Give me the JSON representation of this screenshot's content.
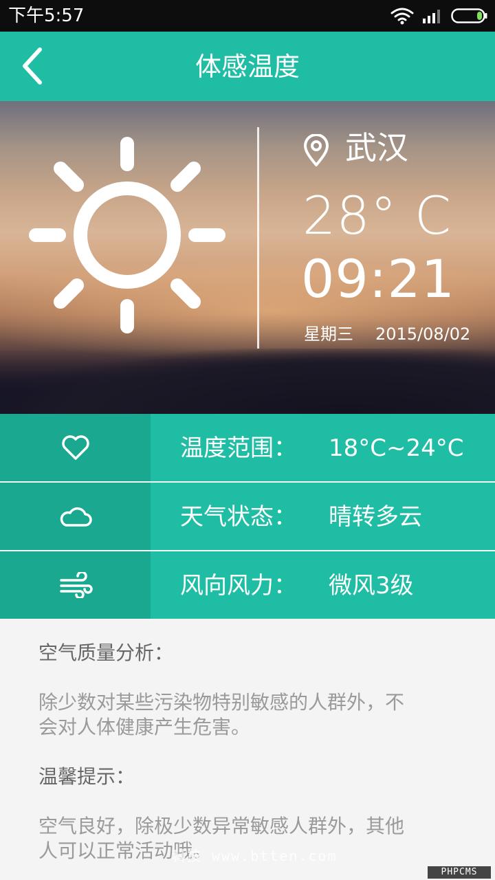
{
  "status_bar": {
    "time": "下午5:57",
    "icons": [
      "wifi-icon",
      "signal-icon",
      "battery-icon"
    ]
  },
  "app_bar": {
    "title": "体感温度",
    "back_icon": "chevron-left-icon"
  },
  "hero": {
    "location_icon": "map-pin-icon",
    "city": "武汉",
    "temperature": "28° C",
    "time": "09:21",
    "weekday": "星期三",
    "date": "2015/08/02",
    "weather_icon": "sun-icon"
  },
  "info_rows": [
    {
      "icon": "heart-icon",
      "label": "温度范围：",
      "value": "18°C~24°C"
    },
    {
      "icon": "cloud-icon",
      "label": "天气状态：",
      "value": "晴转多云"
    },
    {
      "icon": "wind-icon",
      "label": "风向风力：",
      "value": "微风3级"
    }
  ],
  "analysis": {
    "air_quality_heading": "空气质量分析：",
    "air_quality_line1": "除少数对某些污染物特别敏感的人群外，不",
    "air_quality_line2": "会对人体健康产生危害。",
    "tips_heading": "温馨提示：",
    "tips_line1": "空气良好，除极少数异常敏感人群外，其他",
    "tips_line2": "人可以正常活动哦。"
  },
  "watermark": "科技 www.btten.com",
  "corner_badge": "PHPCMS",
  "colors": {
    "accent": "#1ebda4",
    "accent_dark": "#1aa890",
    "background": "#f4f4f4",
    "status_bar": "#0d0d0d"
  }
}
